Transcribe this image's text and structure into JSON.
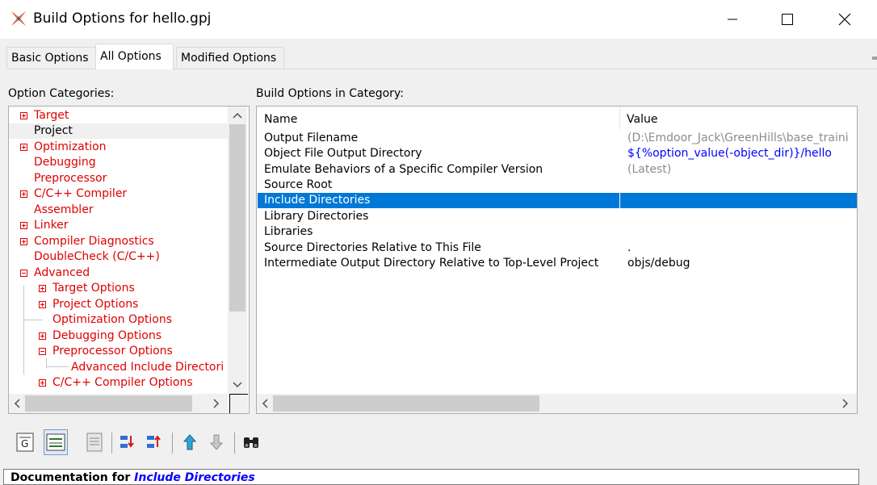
{
  "window": {
    "title": "Build Options for hello.gpj",
    "minimize_glyph": "—",
    "maximize_glyph": "☐",
    "close_glyph": "✕"
  },
  "tabs": [
    {
      "label": "Basic Options",
      "active": false
    },
    {
      "label": "All Options",
      "active": true
    },
    {
      "label": "Modified Options",
      "active": false
    }
  ],
  "left_panel": {
    "label": "Option Categories:",
    "items": [
      {
        "label": "Target",
        "expander": "collapsed",
        "selected": false
      },
      {
        "label": "Project",
        "expander": "none",
        "selected": true
      },
      {
        "label": "Optimization",
        "expander": "collapsed",
        "selected": false
      },
      {
        "label": "Debugging",
        "expander": "none",
        "selected": false
      },
      {
        "label": "Preprocessor",
        "expander": "none",
        "selected": false
      },
      {
        "label": "C/C++ Compiler",
        "expander": "collapsed",
        "selected": false
      },
      {
        "label": "Assembler",
        "expander": "none",
        "selected": false
      },
      {
        "label": "Linker",
        "expander": "collapsed",
        "selected": false
      },
      {
        "label": "Compiler Diagnostics",
        "expander": "collapsed",
        "selected": false
      },
      {
        "label": "DoubleCheck (C/C++)",
        "expander": "none",
        "selected": false
      },
      {
        "label": "Advanced",
        "expander": "expanded",
        "selected": false
      },
      {
        "label": "Target Options",
        "expander": "collapsed",
        "selected": false
      },
      {
        "label": "Project Options",
        "expander": "collapsed",
        "selected": false
      },
      {
        "label": "Optimization Options",
        "expander": "none",
        "selected": false
      },
      {
        "label": "Debugging Options",
        "expander": "collapsed",
        "selected": false
      },
      {
        "label": "Preprocessor Options",
        "expander": "expanded",
        "selected": false
      },
      {
        "label": "Advanced Include Directori",
        "expander": "none",
        "selected": false
      },
      {
        "label": "C/C++ Compiler Options",
        "expander": "collapsed",
        "selected": false
      }
    ]
  },
  "right_panel": {
    "label": "Build Options in Category:",
    "columns": {
      "name": "Name",
      "value": "Value"
    },
    "rows": [
      {
        "name": "Output Filename",
        "value": "(D:\\Emdoor_Jack\\GreenHills\\base_traini",
        "style": "gray",
        "selected": false
      },
      {
        "name": "Object File Output Directory",
        "value": "${%option_value(-object_dir)}/hello",
        "style": "blue",
        "selected": false
      },
      {
        "name": "Emulate Behaviors of a Specific Compiler Version",
        "value": "(Latest)",
        "style": "gray",
        "selected": false
      },
      {
        "name": "Source Root",
        "value": "",
        "style": "black",
        "selected": false
      },
      {
        "name": "Include Directories",
        "value": "",
        "style": "black",
        "selected": true
      },
      {
        "name": "Library Directories",
        "value": "",
        "style": "black",
        "selected": false
      },
      {
        "name": "Libraries",
        "value": "",
        "style": "black",
        "selected": false
      },
      {
        "name": "Source Directories Relative to This File",
        "value": ".",
        "style": "black",
        "selected": false
      },
      {
        "name": "Intermediate Output Directory Relative to Top-Level Project",
        "value": "objs/debug",
        "style": "black",
        "selected": false
      }
    ]
  },
  "toolbar": {
    "buttons": [
      {
        "icon": "gray-text-icon",
        "pressed": false
      },
      {
        "icon": "list-view-icon",
        "pressed": true
      },
      {
        "icon": "document-icon",
        "pressed": false
      },
      {
        "icon": "add-below-icon",
        "pressed": false
      },
      {
        "icon": "add-above-icon",
        "pressed": false
      },
      {
        "icon": "move-up-icon",
        "pressed": false
      },
      {
        "icon": "move-down-icon",
        "pressed": false
      },
      {
        "icon": "binoculars-icon",
        "pressed": false
      }
    ]
  },
  "documentation": {
    "prefix": "Documentation for ",
    "topic": "Include Directories"
  },
  "colors": {
    "category_text": "#e00000",
    "selection": "#0078d7",
    "value_blue": "#0000ff",
    "value_gray": "#8c8c8c"
  }
}
